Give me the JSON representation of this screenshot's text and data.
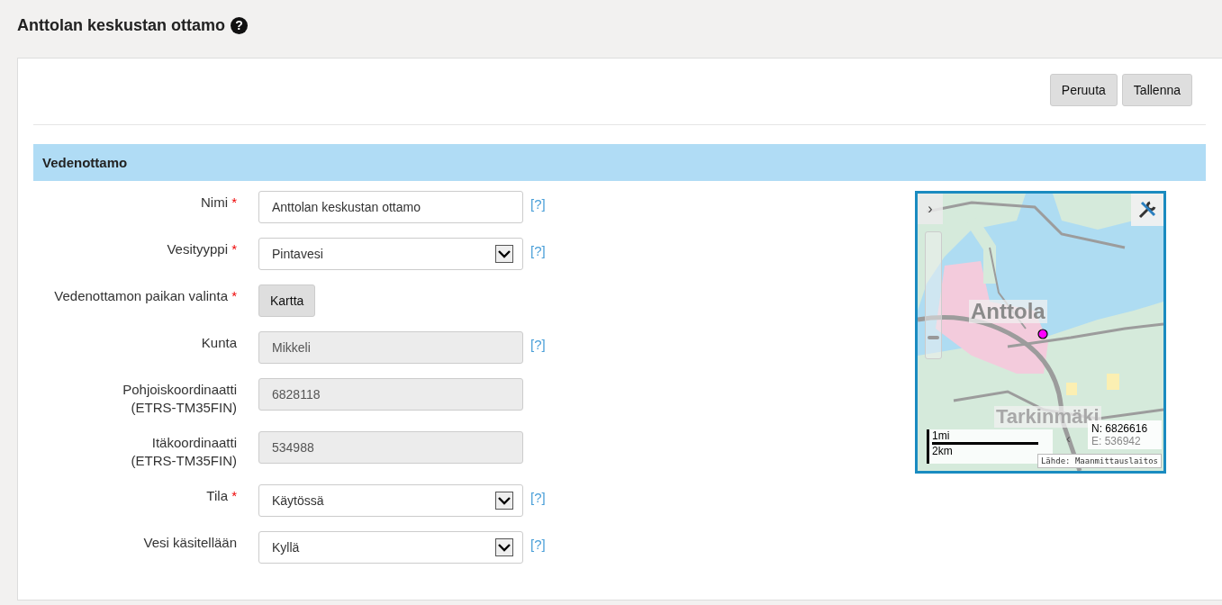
{
  "page": {
    "title": "Anttolan keskustan ottamo",
    "help_icon": "?"
  },
  "actions": [
    {
      "label": "Peruuta"
    },
    {
      "label": "Tallenna"
    }
  ],
  "section": {
    "title": "Vedenottamo"
  },
  "fields": [
    {
      "kind": "text",
      "label": "Nimi",
      "required_mark": "*",
      "value": "Anttolan keskustan ottamo",
      "disabled": false,
      "help": "[?]"
    },
    {
      "kind": "select",
      "label": "Vesityyppi",
      "required_mark": "*",
      "value": "Pintavesi",
      "disabled": false,
      "help": "[?]"
    },
    {
      "kind": "button",
      "label": "Vedenottamon paikan valinta",
      "required_mark": "*",
      "value": "Kartta"
    },
    {
      "kind": "text",
      "label": "Kunta",
      "value": "Mikkeli",
      "disabled": true,
      "help": "[?]"
    },
    {
      "kind": "text",
      "label": "Pohjoiskoordinaatti",
      "sublabel": "(ETRS-TM35FIN)",
      "value": "6828118",
      "disabled": true
    },
    {
      "kind": "text",
      "label": "Itäkoordinaatti",
      "sublabel": "(ETRS-TM35FIN)",
      "value": "534988",
      "disabled": true
    },
    {
      "kind": "select",
      "label": "Tila",
      "required_mark": "*",
      "value": "Käytössä",
      "disabled": false,
      "help": "[?]"
    },
    {
      "kind": "select",
      "label": "Vesi käsitellään",
      "value": "Kyllä",
      "disabled": false,
      "help": "[?]"
    }
  ],
  "map": {
    "zoom": {
      "level": 0.15
    },
    "expand": "›",
    "place_labels": [
      "Anttola",
      "Tarkinmäki"
    ],
    "scale_top": "1mi",
    "scale_bottom": "2km",
    "collapse": "‹",
    "north": "N: 6826616",
    "east": "E: 536942",
    "source": "Lähde: Maanmittauslaitos"
  }
}
